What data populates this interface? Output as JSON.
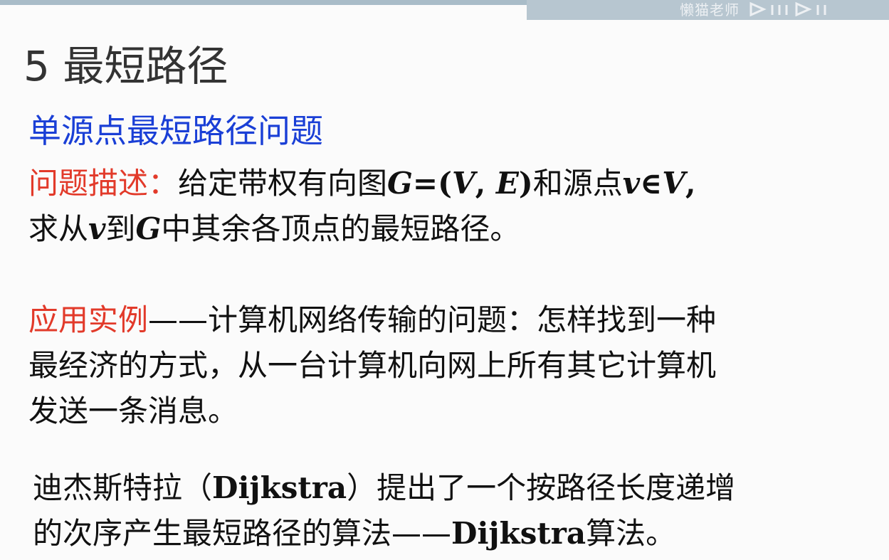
{
  "header": {
    "watermark_text": "懒猫老师",
    "watermark_logo": "bilibili-logo"
  },
  "slide": {
    "title": "5 最短路径",
    "subtitle": "单源点最短路径问题",
    "description": {
      "label": "问题描述：",
      "line1_a": "给定带权有向图",
      "line1_math_G": "G",
      "line1_eq": "=(",
      "line1_math_V": "V",
      "line1_comma": ", ",
      "line1_math_E": "E",
      "line1_close": ")",
      "line1_b": "和源点",
      "line1_math_v": "v",
      "line1_in": "∈",
      "line1_math_V2": "V",
      "line1_end": ",",
      "line2_a": "求从",
      "line2_math_v": "v",
      "line2_b": "到",
      "line2_math_G": "G",
      "line2_c": "中其余各顶点的最短路径。"
    },
    "application": {
      "label": "应用实例",
      "line1": "——计算机网络传输的问题：怎样找到一种",
      "line2": "最经济的方式，从一台计算机向网上所有其它计算机",
      "line3": "发送一条消息。"
    },
    "dijkstra": {
      "line1_a": "迪杰斯特拉（",
      "line1_name": "Dijkstra",
      "line1_b": "）提出了一个按路径长度递增",
      "line2_a": "的次序产生最短路径的算法——",
      "line2_name": "Dijkstra",
      "line2_b": "算法。"
    }
  }
}
